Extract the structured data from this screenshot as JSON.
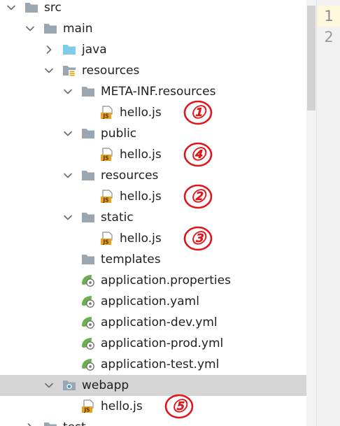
{
  "tree": [
    {
      "name": "tree-node-src",
      "label": "src",
      "icon": "folder",
      "expanded": true,
      "depth": 0
    },
    {
      "name": "tree-node-main",
      "label": "main",
      "icon": "folder",
      "expanded": true,
      "depth": 1
    },
    {
      "name": "tree-node-java",
      "label": "java",
      "icon": "source-folder",
      "expanded": false,
      "depth": 2
    },
    {
      "name": "tree-node-resources-root",
      "label": "resources",
      "icon": "resource-folder",
      "expanded": true,
      "depth": 2
    },
    {
      "name": "tree-node-meta-inf-resources",
      "label": "META-INF.resources",
      "icon": "folder",
      "expanded": true,
      "depth": 3
    },
    {
      "name": "tree-node-hello-js-meta-inf",
      "label": "hello.js",
      "icon": "js-file",
      "depth": 4,
      "annotation": "①"
    },
    {
      "name": "tree-node-public",
      "label": "public",
      "icon": "folder",
      "expanded": true,
      "depth": 3
    },
    {
      "name": "tree-node-hello-js-public",
      "label": "hello.js",
      "icon": "js-file",
      "depth": 4,
      "annotation": "④"
    },
    {
      "name": "tree-node-resources",
      "label": "resources",
      "icon": "folder",
      "expanded": true,
      "depth": 3
    },
    {
      "name": "tree-node-hello-js-resources",
      "label": "hello.js",
      "icon": "js-file",
      "depth": 4,
      "annotation": "②"
    },
    {
      "name": "tree-node-static",
      "label": "static",
      "icon": "folder",
      "expanded": true,
      "depth": 3
    },
    {
      "name": "tree-node-hello-js-static",
      "label": "hello.js",
      "icon": "js-file",
      "depth": 4,
      "annotation": "③"
    },
    {
      "name": "tree-node-templates",
      "label": "templates",
      "icon": "folder",
      "depth": 3
    },
    {
      "name": "tree-node-application-properties",
      "label": "application.properties",
      "icon": "spring-config-file",
      "depth": 3
    },
    {
      "name": "tree-node-application-yaml",
      "label": "application.yaml",
      "icon": "spring-config-file",
      "depth": 3
    },
    {
      "name": "tree-node-application-dev-yml",
      "label": "application-dev.yml",
      "icon": "spring-config-file",
      "depth": 3
    },
    {
      "name": "tree-node-application-prod-yml",
      "label": "application-prod.yml",
      "icon": "spring-config-file",
      "depth": 3
    },
    {
      "name": "tree-node-application-test-yml",
      "label": "application-test.yml",
      "icon": "spring-config-file",
      "depth": 3
    },
    {
      "name": "tree-node-webapp",
      "label": "webapp",
      "icon": "web-folder",
      "expanded": true,
      "depth": 2,
      "selected": true
    },
    {
      "name": "tree-node-hello-js-webapp",
      "label": "hello.js",
      "icon": "js-file",
      "depth": 3,
      "annotation": "⑤"
    },
    {
      "name": "tree-node-test",
      "label": "test",
      "icon": "folder",
      "expanded": false,
      "depth": 1
    }
  ],
  "gutter": {
    "line_numbers": [
      "1",
      "2"
    ],
    "current_line": "1"
  },
  "colors": {
    "folder": "#9aa7b0",
    "source_folder": "#7fcce8",
    "js_badge": "#e6a21b",
    "spring_leaf": "#6ab04c",
    "selection": "#d5d5d5",
    "annotation_red": "#e0151b",
    "current_line_bg": "#fdf8dc"
  }
}
